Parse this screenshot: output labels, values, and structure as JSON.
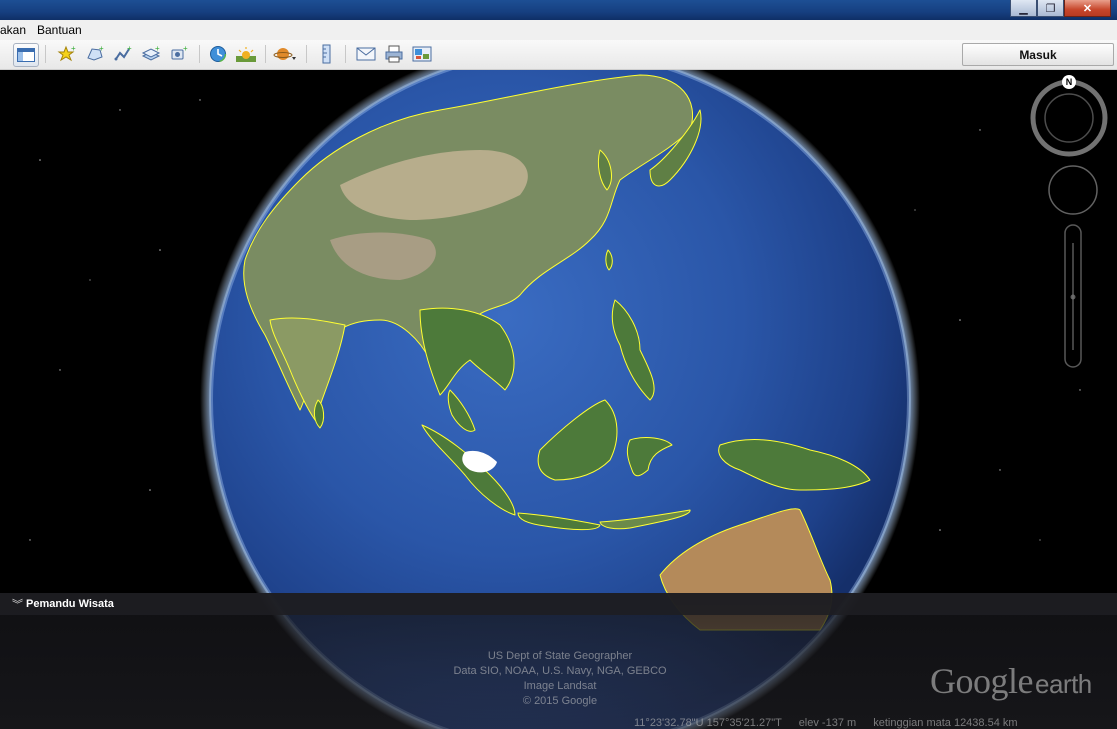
{
  "window": {
    "minimize_icon": "minimize-icon",
    "maximize_icon": "restore-icon",
    "close_icon": "close-icon"
  },
  "menu": {
    "items": [
      "akan",
      "Bantuan"
    ]
  },
  "toolbar": {
    "buttons": [
      "sidebar-toggle-icon",
      "placemark-icon",
      "polygon-icon",
      "path-icon",
      "image-overlay-icon",
      "record-tour-icon",
      "historical-imagery-icon",
      "sunlight-icon",
      "planet-icon",
      "ruler-icon",
      "email-icon",
      "print-icon",
      "view-in-maps-icon"
    ],
    "signin_label": "Masuk"
  },
  "navigation": {
    "north_label": "N"
  },
  "tour_panel": {
    "label": "Pemandu Wisata"
  },
  "credits": {
    "lines": [
      "US Dept of State Geographer",
      "Data SIO, NOAA, U.S. Navy, NGA, GEBCO",
      "Image Landsat",
      "© 2015 Google"
    ]
  },
  "logo": {
    "google": "Google",
    "earth": "earth"
  },
  "status": {
    "coords": "11°23'32.78\"U  157°35'21.27\"T",
    "elev": "elev  -137 m",
    "eye_alt": "ketinggian mata 12438.54 km"
  },
  "colors": {
    "borders": "#ffff33",
    "ocean": "#2a56a8",
    "titlebar": "#163f80"
  }
}
